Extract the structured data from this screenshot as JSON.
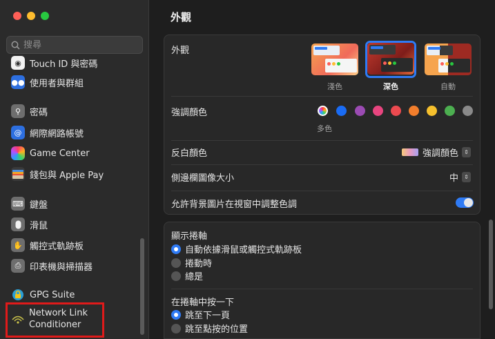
{
  "sidebar": {
    "search_placeholder": "搜尋",
    "items": [
      {
        "label": "Touch ID 與密碼",
        "icon": "fingerprint-icon"
      },
      {
        "label": "使用者與群組",
        "icon": "users-icon"
      },
      {
        "label": "密碼",
        "icon": "key-icon"
      },
      {
        "label": "網際網路帳號",
        "icon": "at-icon"
      },
      {
        "label": "Game Center",
        "icon": "game-center-icon"
      },
      {
        "label": "錢包與 Apple Pay",
        "icon": "wallet-icon"
      },
      {
        "label": "鍵盤",
        "icon": "keyboard-icon"
      },
      {
        "label": "滑鼠",
        "icon": "mouse-icon"
      },
      {
        "label": "觸控式軌跡板",
        "icon": "trackpad-icon"
      },
      {
        "label": "印表機與掃描器",
        "icon": "printer-icon"
      },
      {
        "label": "GPG Suite",
        "icon": "gpg-icon"
      },
      {
        "label": "Network Link Conditioner",
        "icon": "network-link-conditioner-icon"
      }
    ]
  },
  "main": {
    "title": "外觀",
    "appearance": {
      "label": "外觀",
      "options": [
        {
          "label": "淺色",
          "selected": false
        },
        {
          "label": "深色",
          "selected": true
        },
        {
          "label": "自動",
          "selected": false
        }
      ]
    },
    "accent": {
      "label": "強調顏色",
      "caption": "多色",
      "colors": [
        "multicolor",
        "#1a6cf5",
        "#9b4bb3",
        "#e8457f",
        "#ec4a50",
        "#f27e2c",
        "#f6c02d",
        "#4caf50",
        "#8a8a8a"
      ]
    },
    "highlight": {
      "label": "反白顏色",
      "value": "強調顏色"
    },
    "sidebar_icon_size": {
      "label": "側邊欄圖像大小",
      "value": "中"
    },
    "wallpaper_tint": {
      "label": "允許背景圖片在視窗中調整色調",
      "on": true
    },
    "scroll_bars": {
      "label": "顯示捲軸",
      "options": [
        {
          "label": "自動依據滑鼠或觸控式軌跡板",
          "selected": true
        },
        {
          "label": "捲動時",
          "selected": false
        },
        {
          "label": "總是",
          "selected": false
        }
      ]
    },
    "click_scroll": {
      "label": "在捲軸中按一下",
      "options": [
        {
          "label": "跳至下一頁",
          "selected": true
        },
        {
          "label": "跳至點按的位置",
          "selected": false
        }
      ]
    }
  }
}
